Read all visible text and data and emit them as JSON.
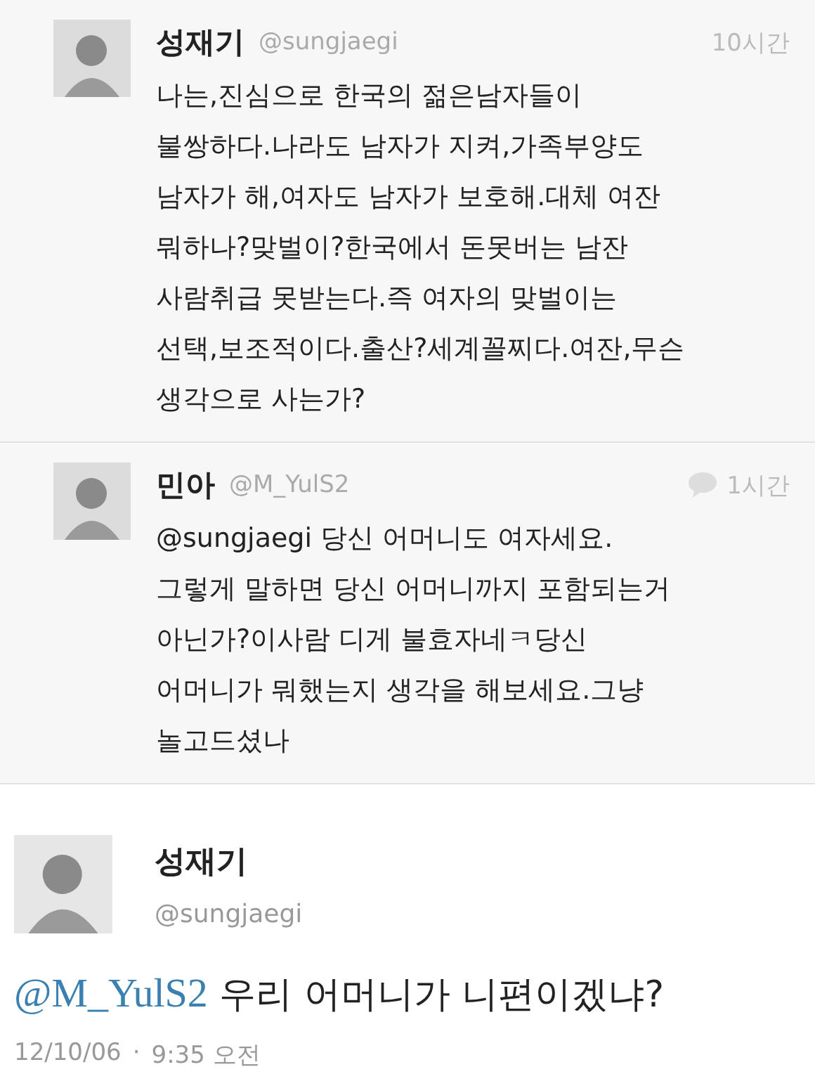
{
  "timeline": [
    {
      "name": "성재기",
      "handle": "@sungjaegi",
      "time": "10시간",
      "has_reply_icon": false,
      "text": "나는,진심으로 한국의 젊은남자들이\n불쌍하다.나라도 남자가 지켜,가족부양도\n남자가 해,여자도 남자가 보호해.대체 여잔\n뭐하나?맞벌이?한국에서 돈못버는 남잔\n사람취급 못받는다.즉 여자의 맞벌이는\n선택,보조적이다.출산?세계꼴찌다.여잔,무슨\n생각으로 사는가?"
    },
    {
      "name": "민아",
      "handle": "@M_YulS2",
      "time": "1시간",
      "has_reply_icon": true,
      "text": "@sungjaegi 당신 어머니도 여자세요.\n그렇게 말하면 당신 어머니까지 포함되는거\n아닌가?이사람 디게 불효자네ㅋ당신\n어머니가 뭐했는지 생각을 해보세요.그냥\n놀고드셨나"
    }
  ],
  "detail": {
    "name": "성재기",
    "handle": "@sungjaegi",
    "mention": "@M_YulS2",
    "text": "우리 어머니가 니편이겠냐?",
    "date": "12/10/06",
    "separator": "·",
    "clock": "9:35 오전"
  }
}
